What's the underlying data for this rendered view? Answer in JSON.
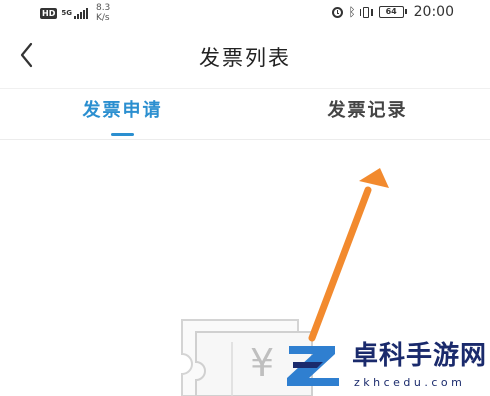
{
  "status_bar": {
    "hd": "HD",
    "network": "5G",
    "speed_value": "8.3",
    "speed_unit": "K/s",
    "battery": "64",
    "time": "20:00",
    "icons": [
      "alarm-icon",
      "bluetooth-icon",
      "vibrate-icon",
      "battery-icon",
      "signal-icon"
    ]
  },
  "header": {
    "title": "发票列表",
    "back_icon": "chevron-left-icon"
  },
  "tabs": [
    {
      "label": "发票申请",
      "active": true
    },
    {
      "label": "发票记录",
      "active": false
    }
  ],
  "colors": {
    "accent": "#2b8fd0",
    "annotation_arrow": "#f28a2e",
    "watermark": "#1a2a6c"
  },
  "empty_state": {
    "currency_symbol": "¥"
  },
  "watermark": {
    "brand": "卓科手游网",
    "url": "zkhcedu.com"
  }
}
